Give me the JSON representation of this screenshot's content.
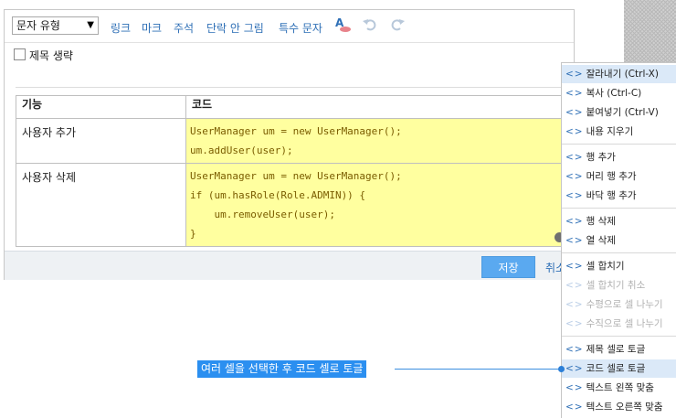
{
  "toolbar": {
    "type_select": "문자 유형",
    "links": [
      "링크",
      "마크",
      "주석",
      "단락 안 그림",
      "특수 문자"
    ],
    "icons": [
      "text-color-icon",
      "undo-icon",
      "redo-icon"
    ]
  },
  "title_toggle": {
    "label": "제목 생략"
  },
  "table": {
    "headers": [
      "기능",
      "코드"
    ],
    "rows": [
      {
        "name": "사용자 추가",
        "code": [
          "UserManager um = new UserManager();",
          "um.addUser(user);"
        ]
      },
      {
        "name": "사용자 삭제",
        "code": [
          "UserManager um = new UserManager();",
          "if (um.hasRole(Role.ADMIN)) {",
          "    um.removeUser(user);",
          "}"
        ]
      }
    ]
  },
  "footer": {
    "save": "저장",
    "cancel": "취소"
  },
  "context_menu": {
    "marker": "<>",
    "items": [
      {
        "label": "잘라내기 (Ctrl-X)",
        "highlighted": true
      },
      {
        "label": "복사 (Ctrl-C)"
      },
      {
        "label": "붙여넣기 (Ctrl-V)"
      },
      {
        "label": "내용 지우기"
      },
      {
        "label": "행 추가"
      },
      {
        "label": "머리 행 추가"
      },
      {
        "label": "바닥 행 추가"
      },
      {
        "label": "행 삭제"
      },
      {
        "label": "열 삭제"
      },
      {
        "label": "셀 합치기"
      },
      {
        "label": "셀 합치기 취소",
        "disabled": true
      },
      {
        "label": "수평으로 셀 나누기",
        "disabled": true
      },
      {
        "label": "수직으로 셀 나누기",
        "disabled": true
      },
      {
        "label": "제목 셀로 토글"
      },
      {
        "label": "코드 셀로 토글",
        "highlighted": true
      },
      {
        "label": "텍스트 왼쪽 맞춤"
      },
      {
        "label": "텍스트 오른쪽 맞춤"
      }
    ]
  },
  "callout": {
    "text": "여러 셀을 선택한 후 코드 셀로 토글"
  },
  "colors": {
    "accent": "#2b8ff0",
    "code_cell": "#ffff9f",
    "link": "#2e6fb6"
  }
}
